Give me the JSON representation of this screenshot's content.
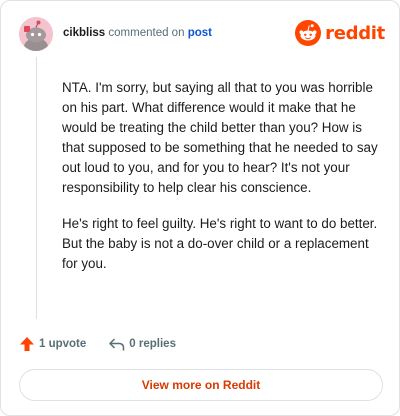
{
  "header": {
    "username": "cikbliss",
    "action_text": "commented on",
    "post_link": "post",
    "logo_text": "reddit"
  },
  "comment": {
    "paragraphs": [
      "NTA. I'm sorry, but saying all that to you was horrible on his part. What difference would it make that he would be treating the child better than you? How is that supposed to be something that he needed to say out loud to you, and for you to hear? It's not your responsibility to help clear his conscience.",
      "He's right to feel guilty. He's right to want to do better. But the baby is not a do-over child or a replacement for you."
    ]
  },
  "actions": {
    "upvotes": "1 upvote",
    "replies": "0 replies"
  },
  "footer": {
    "view_more": "View more on Reddit"
  },
  "colors": {
    "brand": "#ff4500",
    "link": "#0b57d0",
    "view_more": "#d93a00",
    "muted": "#576f76"
  },
  "icons": [
    "snoo-avatar-icon",
    "reddit-logo-icon",
    "upvote-arrow-icon",
    "reply-arrow-icon"
  ]
}
